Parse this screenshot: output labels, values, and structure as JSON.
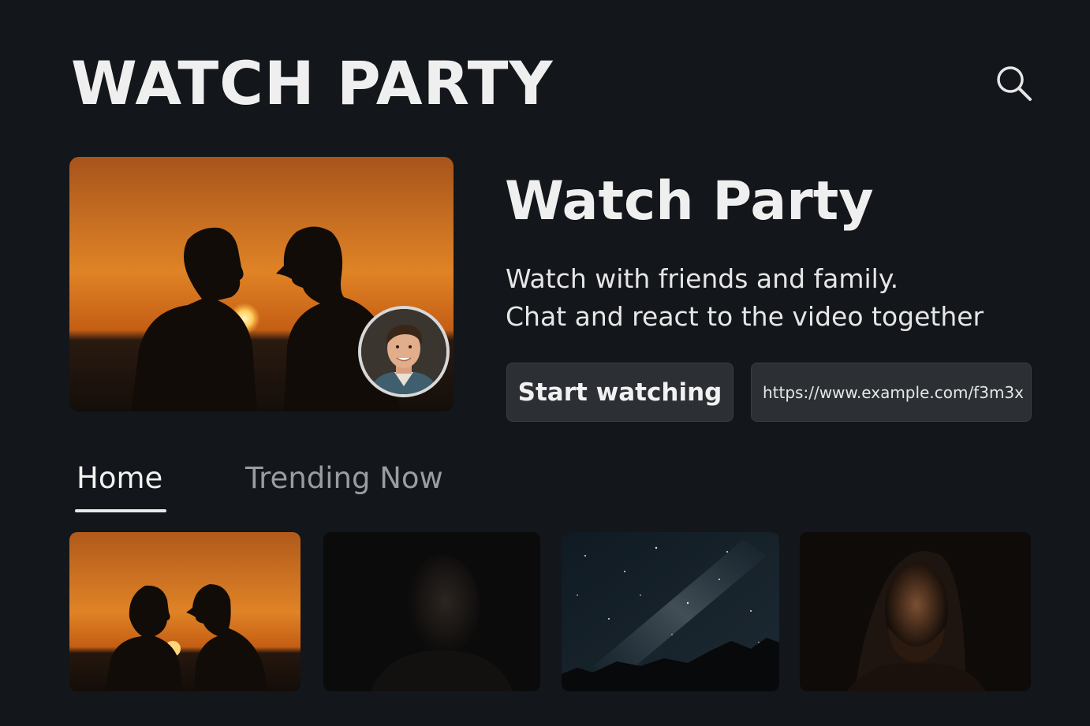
{
  "header": {
    "app_title": "WATCH PARTY",
    "search_icon": "search-icon"
  },
  "hero": {
    "title": "Watch Party",
    "description_line1": "Watch with friends and family.",
    "description_line2": "Chat and react to the video together",
    "start_button_label": "Start watching",
    "share_url": "https://www.example.com/f3m3x"
  },
  "tabs": [
    {
      "label": "Home",
      "active": true
    },
    {
      "label": "Trending Now",
      "active": false
    }
  ],
  "thumbnails": [
    {
      "subject": "sunset-silhouettes"
    },
    {
      "subject": "dark-portrait-man"
    },
    {
      "subject": "night-sky-mountains"
    },
    {
      "subject": "bearded-man-portrait"
    }
  ],
  "colors": {
    "background": "#13161a",
    "button_bg": "#2c2f33",
    "sunset_orange": "#d9731f",
    "tab_active": "#f2f2f2",
    "tab_inactive": "#9a9c9f"
  }
}
